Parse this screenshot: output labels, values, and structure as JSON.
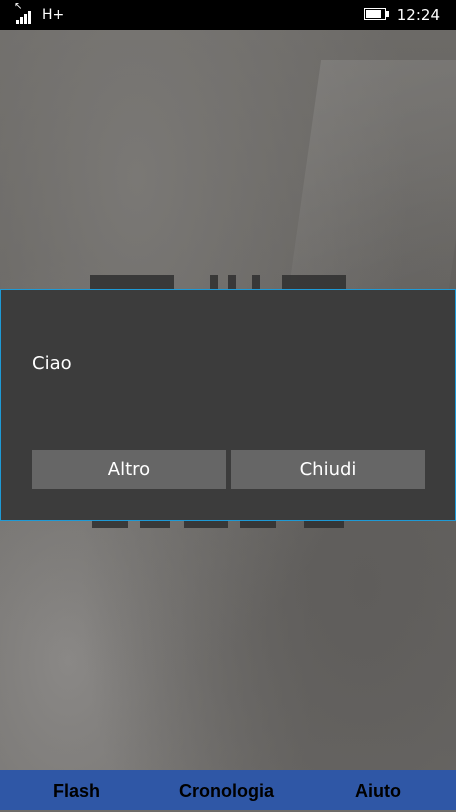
{
  "status_bar": {
    "network": "H+",
    "time": "12:24",
    "icons": [
      "signal-icon",
      "data-activity-icon",
      "battery-icon"
    ]
  },
  "dialog": {
    "message": "Ciao",
    "buttons": {
      "more": "Altro",
      "close": "Chiudi"
    },
    "border_color": "#1e9ad6",
    "background_color": "#3c3c3c"
  },
  "app_bar": {
    "items": [
      "Flash",
      "Cronologia",
      "Aiuto"
    ],
    "background_color": "#2f57a6"
  }
}
